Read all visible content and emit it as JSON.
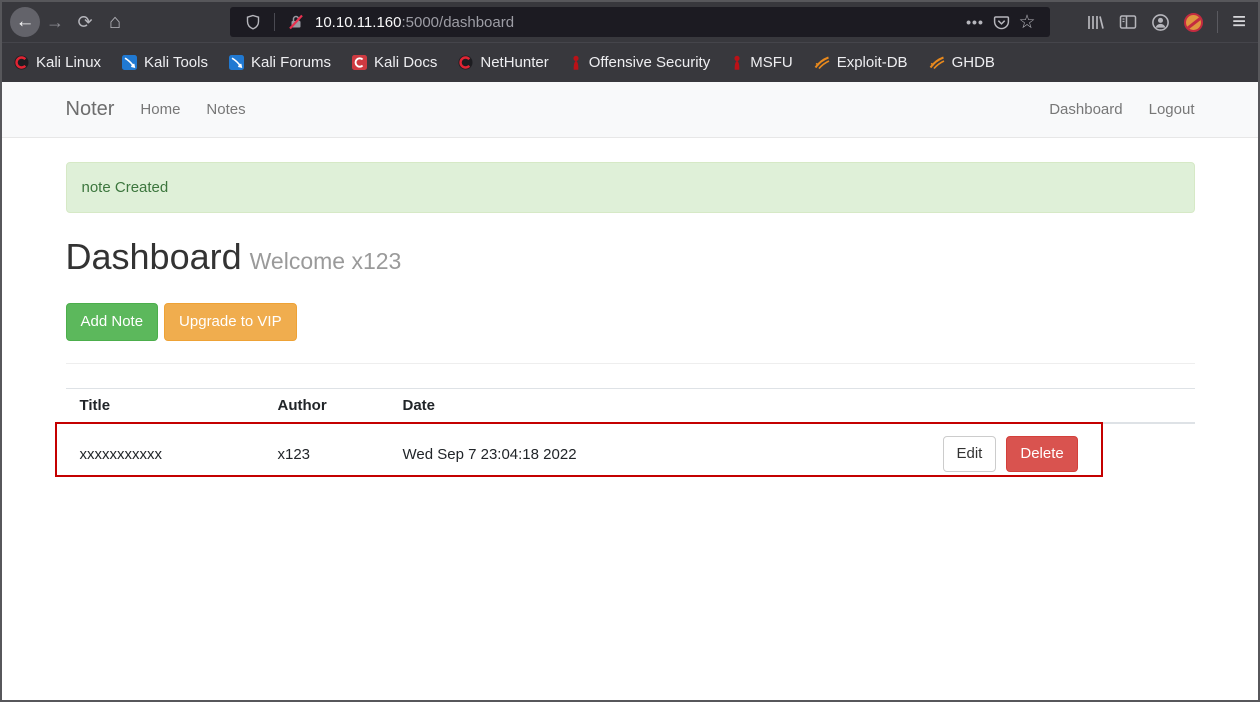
{
  "chrome": {
    "toolbar": {
      "url_host": "10.10.11.160",
      "url_path": ":5000/dashboard",
      "icons": [
        "back-icon",
        "forward-icon",
        "reload-icon",
        "home-icon",
        "shield-icon",
        "insecure-lock-icon",
        "page-actions-icon",
        "pocket-icon",
        "bookmark-star-icon",
        "library-icon",
        "sidebar-icon",
        "account-icon",
        "blocked-addon-icon",
        "menu-icon"
      ],
      "glyphs": {
        "back": "←",
        "forward": "→",
        "reload": "⟳",
        "home": "⌂",
        "dots": "•••",
        "star": "☆",
        "menu": "≡"
      }
    },
    "bookmarks": [
      {
        "label": "Kali Linux",
        "icon": "kali-dragon-icon"
      },
      {
        "label": "Kali Tools",
        "icon": "kali-tools-icon"
      },
      {
        "label": "Kali Forums",
        "icon": "kali-forums-icon"
      },
      {
        "label": "Kali Docs",
        "icon": "kali-docs-icon"
      },
      {
        "label": "NetHunter",
        "icon": "kali-dragon-icon"
      },
      {
        "label": "Offensive Security",
        "icon": "offsec-icon"
      },
      {
        "label": "MSFU",
        "icon": "offsec-icon"
      },
      {
        "label": "Exploit-DB",
        "icon": "exploitdb-icon"
      },
      {
        "label": "GHDB",
        "icon": "exploitdb-icon"
      }
    ]
  },
  "page": {
    "navbar": {
      "brand": "Noter",
      "left_links": [
        {
          "label": "Home"
        },
        {
          "label": "Notes"
        }
      ],
      "right_links": [
        {
          "label": "Dashboard"
        },
        {
          "label": "Logout"
        }
      ]
    },
    "alert": {
      "message": "note Created"
    },
    "heading": {
      "title": "Dashboard",
      "subtitle": "Welcome x123"
    },
    "actions": {
      "add_note": "Add Note",
      "upgrade_vip": "Upgrade to VIP"
    },
    "table": {
      "headers": [
        "Title",
        "Author",
        "Date"
      ],
      "rows": [
        {
          "title": "xxxxxxxxxxx",
          "author": "x123",
          "date": "Wed Sep 7 23:04:18 2022",
          "edit_label": "Edit",
          "delete_label": "Delete"
        }
      ]
    },
    "colors": {
      "success_button": "#5cb85c",
      "warning_button": "#f0ad4e",
      "danger_button": "#d9534f",
      "alert_bg": "#dff0d8",
      "alert_text": "#3c763d",
      "annotation_border": "#c40000",
      "navbar_bg": "#f8f9fa",
      "chrome_bg": "#38383d",
      "urlbar_bg": "#1c1b22"
    }
  }
}
